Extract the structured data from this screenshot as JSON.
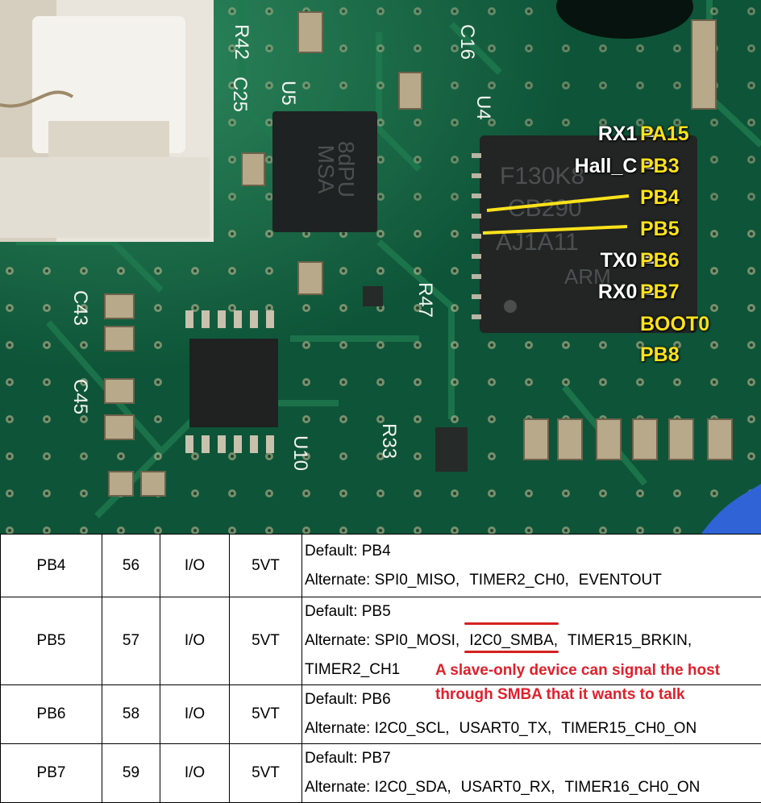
{
  "photo": {
    "board_labels": [
      "R42",
      "C16",
      "C25",
      "U5",
      "U4",
      "R47",
      "C43",
      "C45",
      "R33",
      "U10"
    ],
    "mcu_marking": [
      "F130K8",
      "CB290",
      "AJ1A11",
      "ARM"
    ],
    "sensor_marking": [
      "MSA",
      "8dPU"
    ]
  },
  "pin_labels": [
    {
      "signal": "RX1 =",
      "pin": "PA15"
    },
    {
      "signal": "Hall_C =",
      "pin": "PB3"
    },
    {
      "signal": "",
      "pin": "PB4"
    },
    {
      "signal": "",
      "pin": "PB5"
    },
    {
      "signal": "TX0 =",
      "pin": "PB6"
    },
    {
      "signal": "RX0 =",
      "pin": "PB7"
    },
    {
      "signal": "",
      "pin": "BOOT0"
    },
    {
      "signal": "",
      "pin": "PB8"
    }
  ],
  "table": {
    "rows": [
      {
        "pin": "PB4",
        "num": "56",
        "type": "I/O",
        "level": "5VT",
        "default": "Default:  PB4",
        "alt_prefix": "Alternate:  SPI0_MISO,",
        "alt_items": [
          "TIMER2_CH0,",
          "EVENTOUT"
        ]
      },
      {
        "pin": "PB5",
        "num": "57",
        "type": "I/O",
        "level": "5VT",
        "default": "Default:  PB5",
        "alt_prefix": "Alternate:  SPI0_MOSI,",
        "alt_highlight": "I2C0_SMBA",
        "alt_items": [
          ",",
          "TIMER15_BRKIN,"
        ],
        "alt_cont": "TIMER2_CH1"
      },
      {
        "pin": "PB6",
        "num": "58",
        "type": "I/O",
        "level": "5VT",
        "default": "Default:  PB6",
        "alt_prefix": "Alternate:  I2C0_SCL,",
        "alt_items": [
          "USART0_TX,",
          "TIMER15_CH0_ON"
        ]
      },
      {
        "pin": "PB7",
        "num": "59",
        "type": "I/O",
        "level": "5VT",
        "default": "Default:  PB7",
        "alt_prefix": "Alternate:  I2C0_SDA,",
        "alt_items": [
          "USART0_RX,",
          "TIMER16_CH0_ON"
        ]
      }
    ]
  },
  "annotation": {
    "line1": "A slave-only device can signal the host",
    "line2": "through SMBA that it wants to talk",
    "color": "#e0202a"
  },
  "colors": {
    "pcb": "#0f5a3c",
    "label": "#ffe21a",
    "marker": "#ffe21a",
    "underline": "#d42020"
  }
}
